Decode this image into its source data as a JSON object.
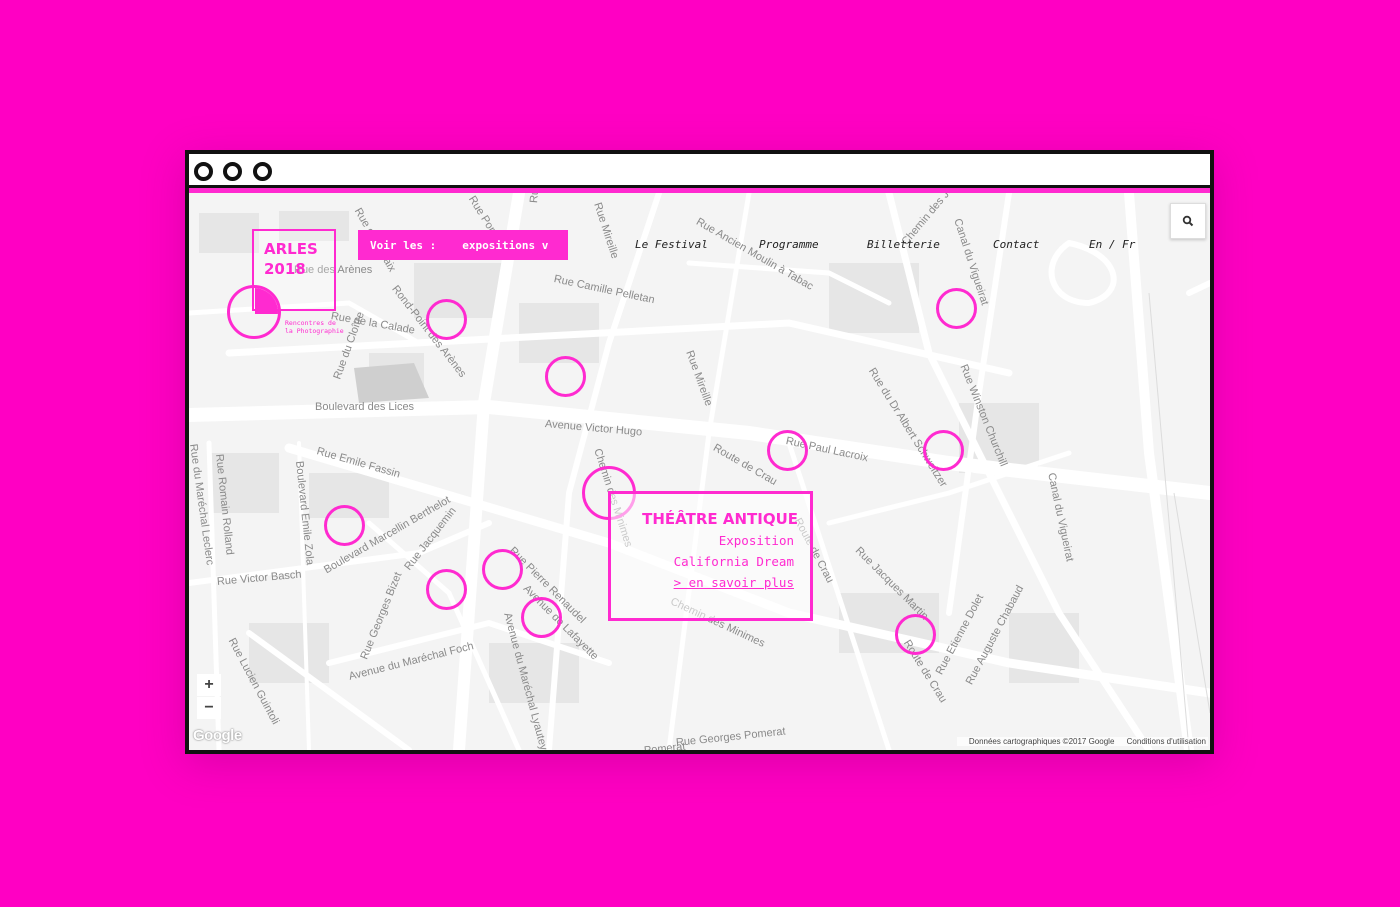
{
  "window": {
    "controls": [
      "close",
      "minimize",
      "maximize"
    ]
  },
  "logo": {
    "line1": "ARLES",
    "line2": "2018",
    "subtitle": "Rencontres de la Photographie"
  },
  "filter": {
    "label": "Voir les :",
    "selected": "expositions v"
  },
  "nav": {
    "items": [
      "Le Festival",
      "Programme",
      "Billetterie",
      "Contact"
    ],
    "language": "En / Fr"
  },
  "search": {
    "icon": "search-icon"
  },
  "streets": [
    "Rue des Arènes",
    "Rue de la Calade",
    "Rue du Cloître",
    "Rond-Point des Arènes",
    "Rue Camille Pelletan",
    "Rue Ancien Moulin à Tabac",
    "Chemin des Jonquiers",
    "Canal du Vigueirat",
    "Rue Mireille",
    "Rue Mireille",
    "Boulevard des Lices",
    "Avenue Victor Hugo",
    "Route de Crau",
    "Rue Paul Lacroix",
    "Rue du Dr Albert Schweitzer",
    "Rue Winston Churchill",
    "Canal du Vigueirat",
    "Rue Emile Fassin",
    "Rue du Maréchal Leclerc",
    "Rue Romain Rolland",
    "Boulevard Emile Zola",
    "Rue Victor Basch",
    "Boulevard Marcellin Berthelot",
    "Rue Jacquemin",
    "Rue Georges Bizet",
    "Avenue du Maréchal Foch",
    "Rue Pierre Renaudel",
    "Avenue de Lafayette",
    "Avenue du Maréchal Lyautey",
    "Rue Lucien Guintoli",
    "Chemin des Minimes",
    "Chemin des Minimes",
    "Route de Crau",
    "Rue Jacques Martin",
    "Route de Crau",
    "Rue Etienne Dolet",
    "Rue Auguste Chabaud",
    "Rue Georges Pomerat",
    "Pomerat",
    "Rue de la Paix",
    "Rue Portagnel",
    "Rue Emile"
  ],
  "infobox": {
    "title": "THÉÂTRE ANTIQUE",
    "type": "Exposition",
    "name": "California Dream",
    "link": "> en savoir plus"
  },
  "zoom": {
    "in": "+",
    "out": "−"
  },
  "attribution": {
    "google": "Google",
    "data": "Données cartographiques ©2017 Google",
    "terms": "Conditions d'utilisation"
  },
  "colors": {
    "accent": "#ff2ad0",
    "page_background": "#ff00c3",
    "frame": "#111111",
    "map": "#f4f4f4"
  }
}
